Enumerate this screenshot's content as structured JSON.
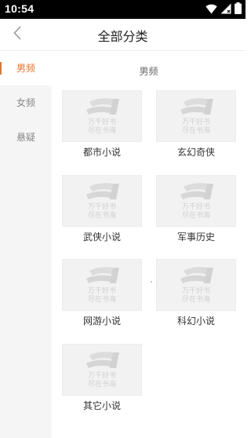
{
  "status_bar": {
    "time": "10:54",
    "icons": [
      "wifi-icon",
      "signal-icon",
      "battery-icon"
    ]
  },
  "header": {
    "back_icon": "chevron-left-icon",
    "title": "全部分类"
  },
  "sidebar": {
    "items": [
      {
        "label": "男频",
        "active": true
      },
      {
        "label": "女频",
        "active": false
      },
      {
        "label": "悬疑",
        "active": false
      }
    ]
  },
  "content": {
    "section_title": "男频",
    "categories": [
      {
        "name": "都市小说",
        "cover_watermark": "万千好书 尽在书海"
      },
      {
        "name": "玄幻奇侠",
        "cover_watermark": "万千好书 尽在书海"
      },
      {
        "name": "武侠小说",
        "cover_watermark": "万千好书 尽在书海"
      },
      {
        "name": "军事历史",
        "cover_watermark": "万千好书 尽在书海"
      },
      {
        "name": "网游小说",
        "cover_watermark": "万千好书 尽在书海"
      },
      {
        "name": "科幻小说",
        "cover_watermark": "万千好书 尽在书海"
      },
      {
        "name": "其它小说",
        "cover_watermark": "万千好书 尽在书海"
      }
    ]
  },
  "colors": {
    "accent": "#e8742a",
    "sidebar_bg": "#f5f5f5",
    "cover_bg": "#f2f2f2"
  }
}
